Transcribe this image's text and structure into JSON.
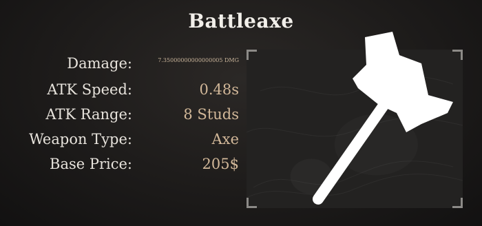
{
  "title": "Battleaxe",
  "stats": [
    {
      "label": "Damage:",
      "value": "7.35000000000000005 DMG"
    },
    {
      "label": "ATK Speed:",
      "value": "0.48s"
    },
    {
      "label": "ATK Range:",
      "value": "8 Studs"
    },
    {
      "label": "Weapon Type:",
      "value": "Axe"
    },
    {
      "label": "Base Price:",
      "value": "205$"
    }
  ],
  "weapon_icon": "battleaxe-icon",
  "colors": {
    "title": "#f2efea",
    "label": "#e7e3dc",
    "value": "#d2b899",
    "panel": "#232221",
    "icon": "#ffffff"
  }
}
